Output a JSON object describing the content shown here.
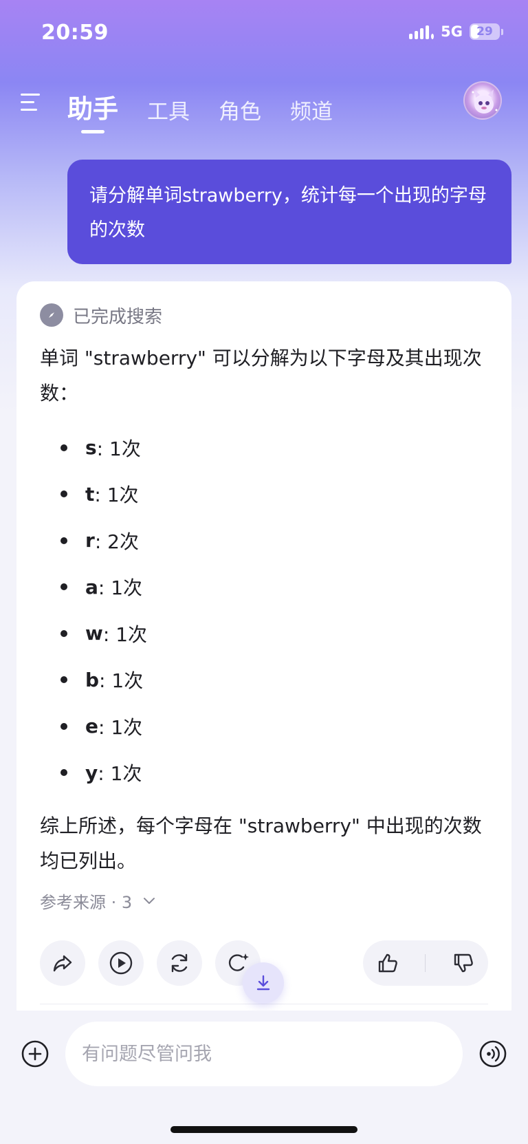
{
  "status_bar": {
    "time": "20:59",
    "network": "5G",
    "battery": "29"
  },
  "nav": {
    "tabs": [
      {
        "label": "助手",
        "active": true
      },
      {
        "label": "工具",
        "active": false
      },
      {
        "label": "角色",
        "active": false
      },
      {
        "label": "频道",
        "active": false
      }
    ]
  },
  "user_message": "请分解单词strawberry，统计每一个出现的字母的次数",
  "answer": {
    "search_status": "已完成搜索",
    "intro": "单词 \"strawberry\" 可以分解为以下字母及其出现次数：",
    "items": [
      {
        "letter": "s",
        "count": ": 1次"
      },
      {
        "letter": "t",
        "count": ": 1次"
      },
      {
        "letter": "r",
        "count": ": 2次"
      },
      {
        "letter": "a",
        "count": ": 1次"
      },
      {
        "letter": "w",
        "count": ": 1次"
      },
      {
        "letter": "b",
        "count": ": 1次"
      },
      {
        "letter": "e",
        "count": ": 1次"
      },
      {
        "letter": "y",
        "count": ": 1次"
      }
    ],
    "summary": "综上所述，每个字母在 \"strawberry\" 中出现的次数均已列出。",
    "sources_label": "参考来源 · 3"
  },
  "input": {
    "placeholder": "有问题尽管问我"
  },
  "colors": {
    "accent": "#5a4ddb",
    "card": "#ffffff",
    "background": "#f3f3fa"
  }
}
